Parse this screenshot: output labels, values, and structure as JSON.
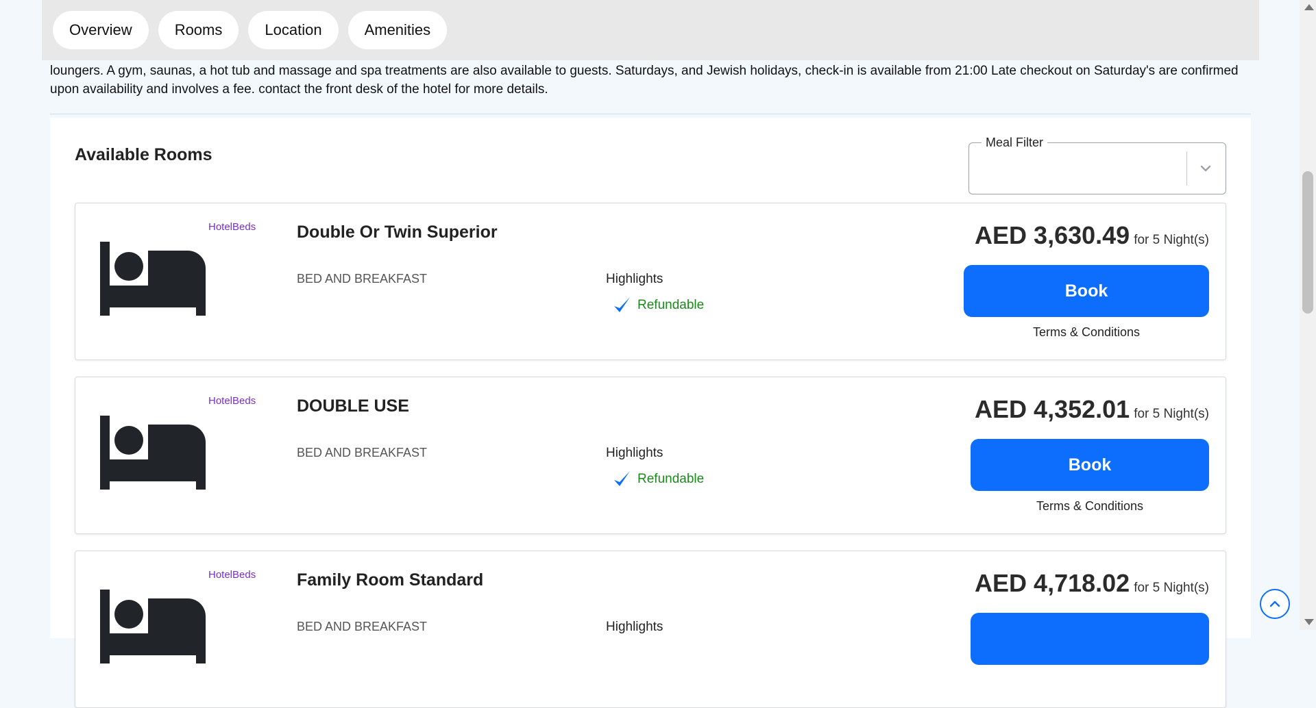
{
  "tabs": [
    "Overview",
    "Rooms",
    "Location",
    "Amenities"
  ],
  "description": "loungers. A gym, saunas, a hot tub and massage and spa treatments are also available to guests. Saturdays, and Jewish holidays, check-in is available from 21:00 Late checkout on Saturday's are confirmed upon availability and involves a fee. contact the front desk of the hotel for more details.",
  "rooms_section": {
    "title": "Available Rooms",
    "meal_filter": {
      "label": "Meal Filter",
      "value": ""
    }
  },
  "rooms": [
    {
      "provider": "HotelBeds",
      "name": "Double Or Twin Superior",
      "board": "BED AND BREAKFAST",
      "highlights_title": "Highlights",
      "highlight": "Refundable",
      "price": "AED 3,630.49",
      "nights": "for 5 Night(s)",
      "book_label": "Book",
      "terms_label": "Terms & Conditions"
    },
    {
      "provider": "HotelBeds",
      "name": "DOUBLE USE",
      "board": "BED AND BREAKFAST",
      "highlights_title": "Highlights",
      "highlight": "Refundable",
      "price": "AED 4,352.01",
      "nights": "for 5 Night(s)",
      "book_label": "Book",
      "terms_label": "Terms & Conditions"
    },
    {
      "provider": "HotelBeds",
      "name": "Family Room Standard",
      "board": "BED AND BREAKFAST",
      "highlights_title": "Highlights",
      "highlight": "",
      "price": "AED 4,718.02",
      "nights": "for 5 Night(s)",
      "book_label": "",
      "terms_label": ""
    }
  ],
  "colors": {
    "accent": "#0d6efd",
    "provider": "#7b2fc9",
    "refundable": "#1a8a1a",
    "tabbar": "#e8e8e8",
    "page_bg": "#f3f8fc"
  },
  "icons": {
    "room_image": "bed-icon",
    "highlight": "check-icon",
    "meal_filter": "chevron-down-icon",
    "back_to_top": "chevron-up-icon"
  }
}
